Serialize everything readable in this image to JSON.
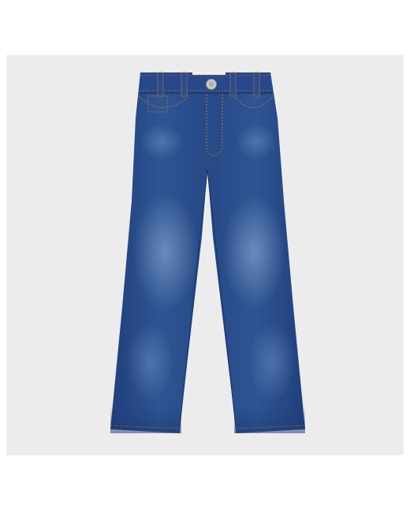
{
  "product": {
    "category": "jeans",
    "wash_color": "#2f4f8f",
    "thread_color": "#b8743a",
    "backdrop_color": "#ececec"
  }
}
